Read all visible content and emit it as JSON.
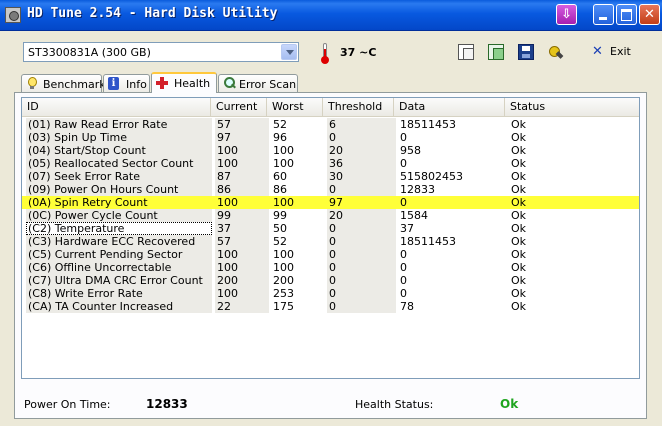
{
  "window": {
    "title": "HD Tune 2.54 - Hard Disk Utility"
  },
  "toolbar": {
    "drive": "ST3300831A (300 GB)",
    "temperature": "37 ~C",
    "exit_label": "Exit"
  },
  "tabs": [
    {
      "label": "Benchmark",
      "icon": "bulb-icon"
    },
    {
      "label": "Info",
      "icon": "info-icon"
    },
    {
      "label": "Health",
      "icon": "health-cross-icon",
      "active": true
    },
    {
      "label": "Error Scan",
      "icon": "magnifier-icon"
    }
  ],
  "table": {
    "columns": [
      "ID",
      "Current",
      "Worst",
      "Threshold",
      "Data",
      "Status"
    ],
    "rows": [
      {
        "id": "(01) Raw Read Error Rate",
        "current": "57",
        "worst": "52",
        "threshold": "6",
        "data": "18511453",
        "status": "Ok"
      },
      {
        "id": "(03) Spin Up Time",
        "current": "97",
        "worst": "96",
        "threshold": "0",
        "data": "0",
        "status": "Ok"
      },
      {
        "id": "(04) Start/Stop Count",
        "current": "100",
        "worst": "100",
        "threshold": "20",
        "data": "958",
        "status": "Ok"
      },
      {
        "id": "(05) Reallocated Sector Count",
        "current": "100",
        "worst": "100",
        "threshold": "36",
        "data": "0",
        "status": "Ok"
      },
      {
        "id": "(07) Seek Error Rate",
        "current": "87",
        "worst": "60",
        "threshold": "30",
        "data": "515802453",
        "status": "Ok"
      },
      {
        "id": "(09) Power On Hours Count",
        "current": "86",
        "worst": "86",
        "threshold": "0",
        "data": "12833",
        "status": "Ok"
      },
      {
        "id": "(0A) Spin Retry Count",
        "current": "100",
        "worst": "100",
        "threshold": "97",
        "data": "0",
        "status": "Ok"
      },
      {
        "id": "(0C) Power Cycle Count",
        "current": "99",
        "worst": "99",
        "threshold": "20",
        "data": "1584",
        "status": "Ok"
      },
      {
        "id": "(C2) Temperature",
        "current": "37",
        "worst": "50",
        "threshold": "0",
        "data": "37",
        "status": "Ok"
      },
      {
        "id": "(C3) Hardware ECC Recovered",
        "current": "57",
        "worst": "52",
        "threshold": "0",
        "data": "18511453",
        "status": "Ok"
      },
      {
        "id": "(C5) Current Pending Sector",
        "current": "100",
        "worst": "100",
        "threshold": "0",
        "data": "0",
        "status": "Ok"
      },
      {
        "id": "(C6) Offline Uncorrectable",
        "current": "100",
        "worst": "100",
        "threshold": "0",
        "data": "0",
        "status": "Ok"
      },
      {
        "id": "(C7) Ultra DMA CRC Error Count",
        "current": "200",
        "worst": "200",
        "threshold": "0",
        "data": "0",
        "status": "Ok"
      },
      {
        "id": "(C8) Write Error Rate",
        "current": "100",
        "worst": "253",
        "threshold": "0",
        "data": "0",
        "status": "Ok"
      },
      {
        "id": "(CA) TA Counter Increased",
        "current": "22",
        "worst": "175",
        "threshold": "0",
        "data": "78",
        "status": "Ok"
      }
    ]
  },
  "footer": {
    "power_on_label": "Power On Time:",
    "power_on_value": "12833",
    "health_label": "Health Status:",
    "health_value": "Ok"
  },
  "colors": {
    "highlight_row": "#ffff38",
    "health_ok": "#1fa51f",
    "titlebar": "#0859e0"
  }
}
